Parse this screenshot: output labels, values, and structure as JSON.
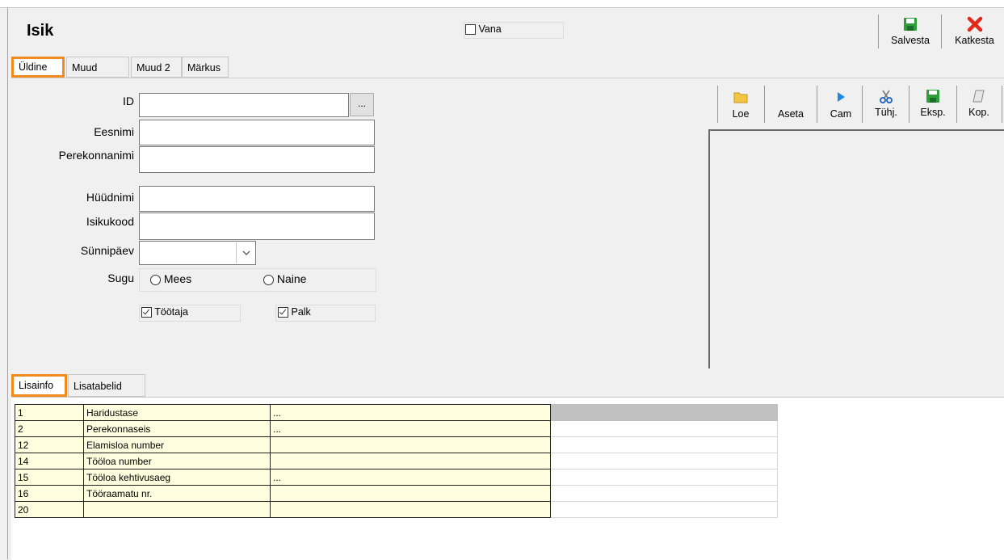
{
  "window": {
    "title": "Isik"
  },
  "header": {
    "vana_label": "Vana"
  },
  "toolbar": {
    "save_label": "Salvesta",
    "cancel_label": "Katkesta"
  },
  "tabs_top": [
    "Üldine",
    "Muud",
    "Muud 2",
    "Märkus"
  ],
  "form": {
    "id_label": "ID",
    "id_button": "...",
    "eesnimi_label": "Eesnimi",
    "perekonnanimi_label": "Perekonnanimi",
    "hyydnimi_label": "Hüüdnimi",
    "isikukood_label": "Isikukood",
    "synnipaev_label": "Sünnipäev",
    "sugu_label": "Sugu",
    "mees_label": "Mees",
    "naine_label": "Naine",
    "tootaja_label": "Töötaja",
    "palk_label": "Palk"
  },
  "photo_toolbar": [
    "Loe",
    "Aseta",
    "Cam",
    "Tühj.",
    "Eksp.",
    "Kop."
  ],
  "tabs_bottom": [
    "Lisainfo",
    "Lisatabelid"
  ],
  "grid_rows": [
    {
      "id": "1",
      "name": "Haridustase",
      "value": "..."
    },
    {
      "id": "2",
      "name": "Perekonnaseis",
      "value": "..."
    },
    {
      "id": "12",
      "name": "Elamisloa number",
      "value": ""
    },
    {
      "id": "14",
      "name": "Tööloa number",
      "value": ""
    },
    {
      "id": "15",
      "name": "Tööloa kehtivusaeg",
      "value": "..."
    },
    {
      "id": "16",
      "name": "Tööraamatu nr.",
      "value": ""
    },
    {
      "id": "20",
      "name": "",
      "value": ""
    }
  ],
  "colors": {
    "highlight": "#f08c1e",
    "grid_cell": "#ffffe0",
    "save_icon": "#2e9e3a",
    "cancel_icon": "#e02a1a"
  }
}
